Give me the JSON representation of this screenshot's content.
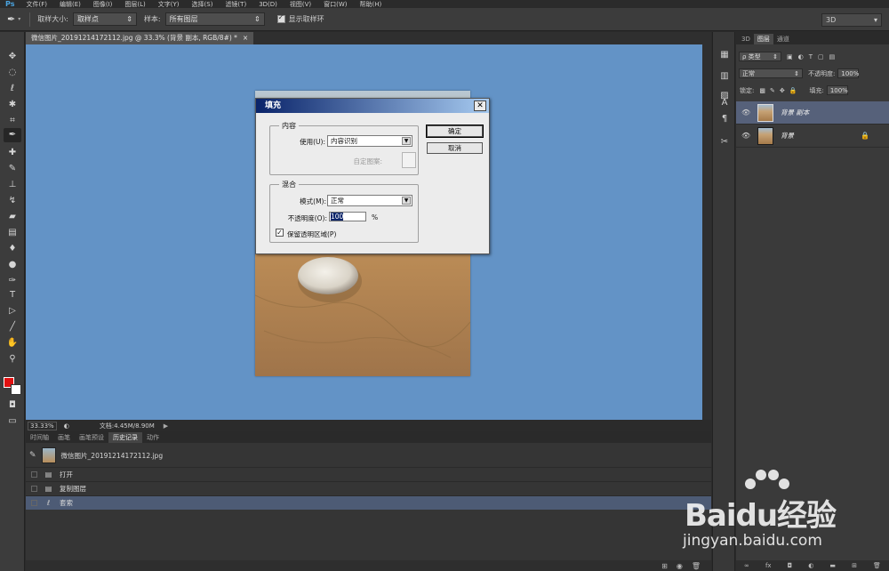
{
  "menubar": {
    "logo": "Ps",
    "items": [
      "文件(F)",
      "编辑(E)",
      "图像(I)",
      "图层(L)",
      "文字(Y)",
      "选择(S)",
      "滤镜(T)",
      "3D(D)",
      "视图(V)",
      "窗口(W)",
      "帮助(H)"
    ]
  },
  "options": {
    "sample_size_label": "取样大小:",
    "sample_size_value": "取样点",
    "sample_label": "样本:",
    "sample_value": "所有图层",
    "show_ring_label": "显示取样环",
    "workspace": "3D"
  },
  "document": {
    "tab_title": "微信图片_20191214172112.jpg @ 33.3% (背景 副本, RGB/8#) *",
    "tab_close": "×",
    "zoom": "33.33%",
    "doc_info": "文档:4.45M/8.90M"
  },
  "history": {
    "tabs": [
      "时间轴",
      "画笔",
      "画笔预设",
      "历史记录",
      "动作"
    ],
    "active_tab": "历史记录",
    "snapshot_label": "微信图片_20191214172112.jpg",
    "rows": [
      {
        "label": "打开",
        "icon": "document-icon"
      },
      {
        "label": "复制图层",
        "icon": "document-icon"
      },
      {
        "label": "套索",
        "icon": "lasso-icon"
      }
    ]
  },
  "layers": {
    "tabs": [
      "3D",
      "图层",
      "通道"
    ],
    "active_tab": "图层",
    "filter_type": "ρ 类型",
    "blend_mode": "正常",
    "opacity_label": "不透明度:",
    "opacity_value": "100%",
    "lock_label": "锁定:",
    "fill_label": "填充:",
    "fill_value": "100%",
    "items": [
      {
        "name": "背景 副本",
        "selected": true
      },
      {
        "name": "背景",
        "selected": false,
        "locked": true
      }
    ]
  },
  "dialog": {
    "title": "填充",
    "close": "✕",
    "content_legend": "内容",
    "use_label": "使用(U):",
    "use_value": "内容识别",
    "custom_pattern_label": "自定图案:",
    "blend_legend": "混合",
    "mode_label": "模式(M):",
    "mode_value": "正常",
    "opacity_label": "不透明度(O):",
    "opacity_value": "100",
    "opacity_unit": "%",
    "preserve_label": "保留透明区域(P)",
    "ok_label": "确定",
    "cancel_label": "取消"
  },
  "watermark": {
    "brand": "Baidu经验",
    "url": "jingyan.baidu.com"
  },
  "colors": {
    "canvas_bg": "#6393c6",
    "foreground": "#e01010",
    "background": "#ffffff",
    "selection": "#4d5b75"
  }
}
